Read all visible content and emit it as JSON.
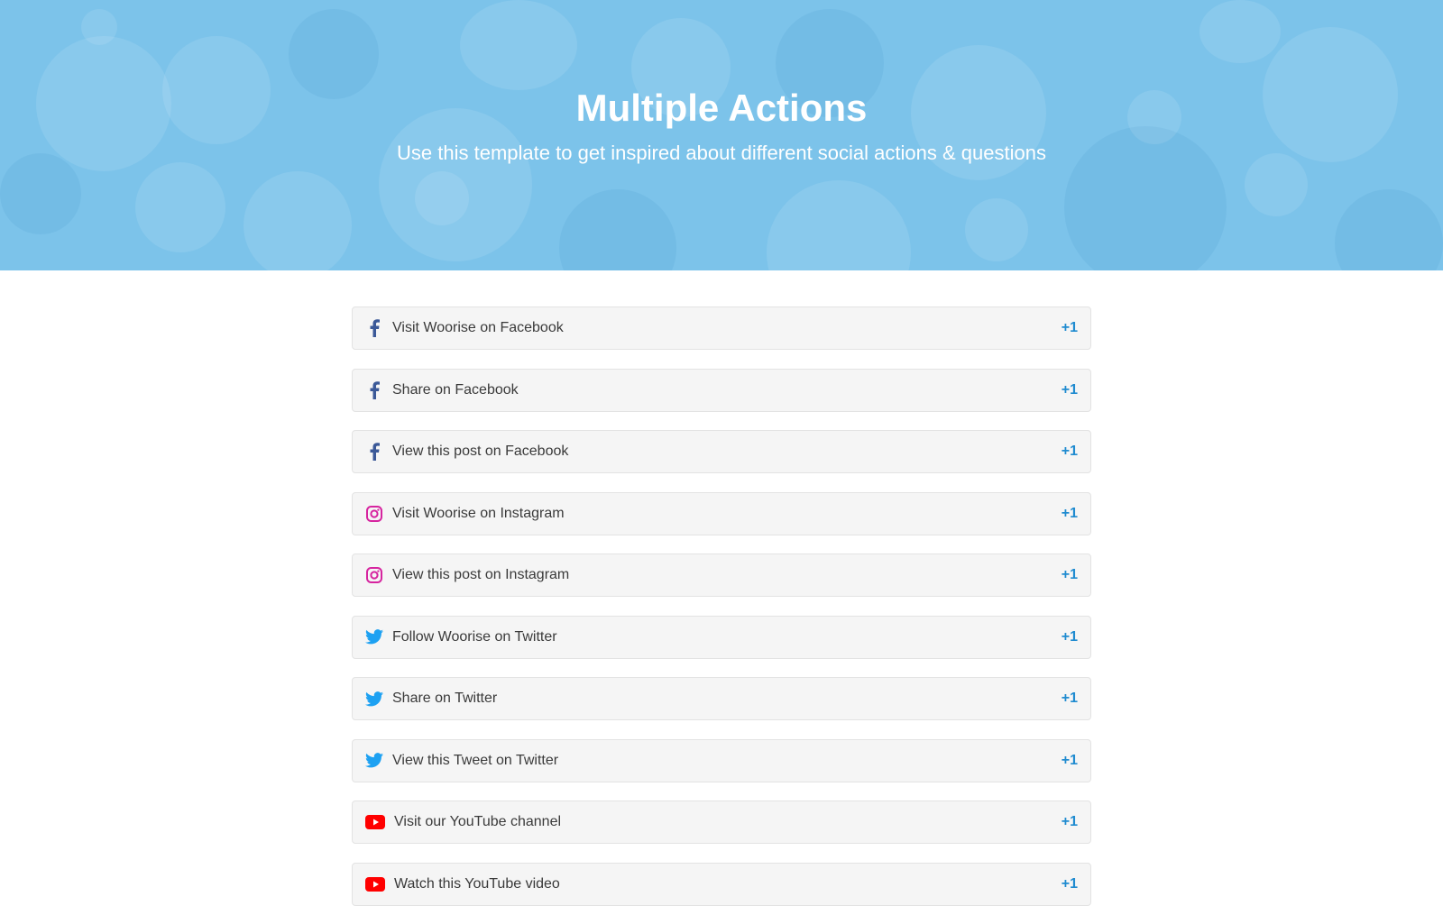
{
  "header": {
    "title": "Multiple Actions",
    "subtitle": "Use this template to get inspired about different social actions & questions"
  },
  "colors": {
    "hero_bg": "#7cc3ea",
    "points": "#1f8bd0",
    "facebook": "#3b5998",
    "instagram": "#d6249f",
    "twitter": "#1da1f2",
    "youtube": "#ff0000"
  },
  "actions": [
    {
      "icon": "facebook-icon",
      "label": "Visit Woorise on Facebook",
      "points": "+1"
    },
    {
      "icon": "facebook-icon",
      "label": "Share on Facebook",
      "points": "+1"
    },
    {
      "icon": "facebook-icon",
      "label": "View this post on Facebook",
      "points": "+1"
    },
    {
      "icon": "instagram-icon",
      "label": "Visit Woorise on Instagram",
      "points": "+1"
    },
    {
      "icon": "instagram-icon",
      "label": "View this post on Instagram",
      "points": "+1"
    },
    {
      "icon": "twitter-icon",
      "label": "Follow Woorise on Twitter",
      "points": "+1"
    },
    {
      "icon": "twitter-icon",
      "label": "Share on Twitter",
      "points": "+1"
    },
    {
      "icon": "twitter-icon",
      "label": "View this Tweet on Twitter",
      "points": "+1"
    },
    {
      "icon": "youtube-icon",
      "label": "Visit our YouTube channel",
      "points": "+1"
    },
    {
      "icon": "youtube-icon",
      "label": "Watch this YouTube video",
      "points": "+1"
    }
  ]
}
